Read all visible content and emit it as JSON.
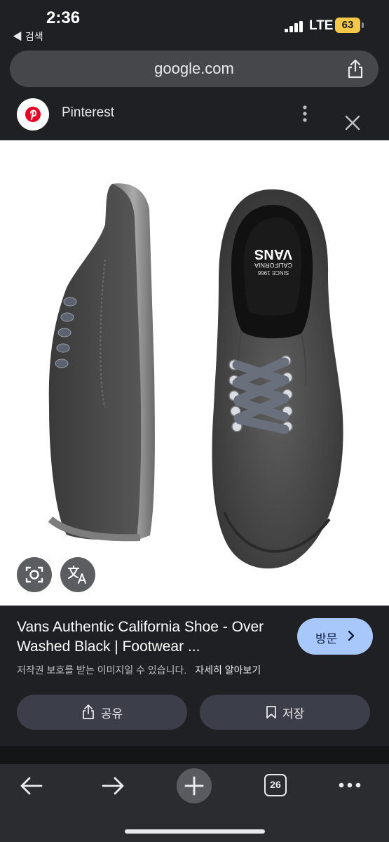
{
  "status_bar": {
    "time": "2:36",
    "back_label": "◀ 검색",
    "network": "LTE",
    "battery": "63"
  },
  "browser": {
    "url": "google.com",
    "tab_count": "26"
  },
  "source": {
    "name": "Pinterest"
  },
  "result": {
    "title": "Vans Authentic California Shoe - Over Washed Black | Footwear ...",
    "visit_label": "방문",
    "copyright_text": "저작권 보호를 받는 이미지일 수 있습니다.",
    "learn_more": "자세히 알아보기",
    "share_label": "공유",
    "save_label": "저장"
  },
  "image": {
    "insole_brand": "VANS",
    "insole_sub": "CALIFORNIA",
    "insole_since": "SINCE 1966"
  },
  "colors": {
    "accent": "#a8c7fa",
    "background": "#1f2023",
    "battery": "#f5c84a"
  },
  "icons": [
    "share-icon",
    "pinterest-icon",
    "more-icon",
    "close-icon",
    "lens-icon",
    "translate-icon",
    "back-arrow-icon",
    "forward-arrow-icon",
    "plus-icon",
    "more-horiz-icon"
  ]
}
